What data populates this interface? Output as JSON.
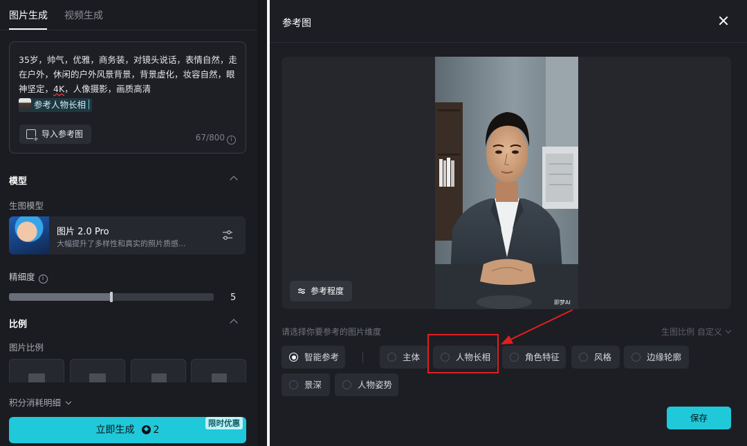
{
  "left_panel": {
    "tabs": [
      {
        "label": "图片生成",
        "active": true
      },
      {
        "label": "视频生成",
        "active": false
      }
    ],
    "prompt": {
      "text_part1": "35岁，帅气，优雅，商务装，对镜头说话，表情自然，走在户外，休闲的户外风景背景，背景虚化，妆容自然，眼神坚定，",
      "text_kw": "4K",
      "text_part2": "，人像摄影，画质高清",
      "reference_chip": "参考人物长相",
      "import_button": "导入参考图",
      "counter": "67/800"
    },
    "model_section": {
      "title": "模型",
      "sub_label": "生图模型",
      "model_name": "图片 2.0 Pro",
      "model_desc": "大幅提升了多样性和真实的照片质感..."
    },
    "detail": {
      "label": "精细度",
      "value": "5",
      "level_fraction": 0.5
    },
    "ratio_section": {
      "title": "比例",
      "sub_label": "图片比例"
    },
    "cost_detail": "积分消耗明细",
    "generate": {
      "label": "立即生成",
      "cost": "2",
      "promo": "限时优惠"
    },
    "colors": {
      "accent": "#1fc9d9",
      "bg": "#1b1c21"
    }
  },
  "modal": {
    "title": "参考图",
    "degree_button": "参考程度",
    "watermark": "即梦AI",
    "dimension_prompt": "请选择你要参考的图片维度",
    "ratio_label": "生图比例 自定义",
    "options": [
      {
        "label": "智能参考",
        "selected": true
      },
      {
        "label": "主体",
        "selected": false
      },
      {
        "label": "人物长相",
        "selected": false,
        "highlighted": true
      },
      {
        "label": "角色特征",
        "selected": false
      },
      {
        "label": "风格",
        "selected": false
      },
      {
        "label": "边缘轮廓",
        "selected": false
      },
      {
        "label": "景深",
        "selected": false
      },
      {
        "label": "人物姿势",
        "selected": false
      }
    ],
    "save_button": "保存",
    "annotation_color": "#e02020"
  }
}
